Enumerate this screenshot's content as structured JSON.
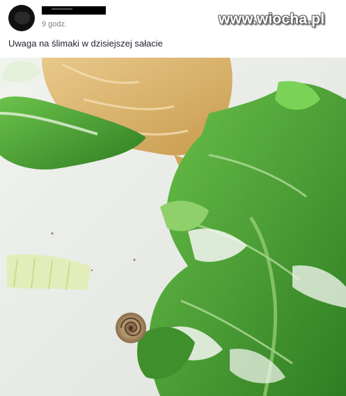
{
  "post": {
    "timestamp": "9 godz.",
    "text": "Uwaga na ślimaki w dzisiejszej sałacie"
  },
  "watermark": "www.wiocha.pl",
  "photo": {
    "subject": "salad-with-snail"
  },
  "colors": {
    "plate": "#e9ebe8",
    "lettuce": "#3f9a2f",
    "dressing": "#f4f6f2",
    "onion": "#d8b36a",
    "snail_shell": "#a88a66"
  }
}
